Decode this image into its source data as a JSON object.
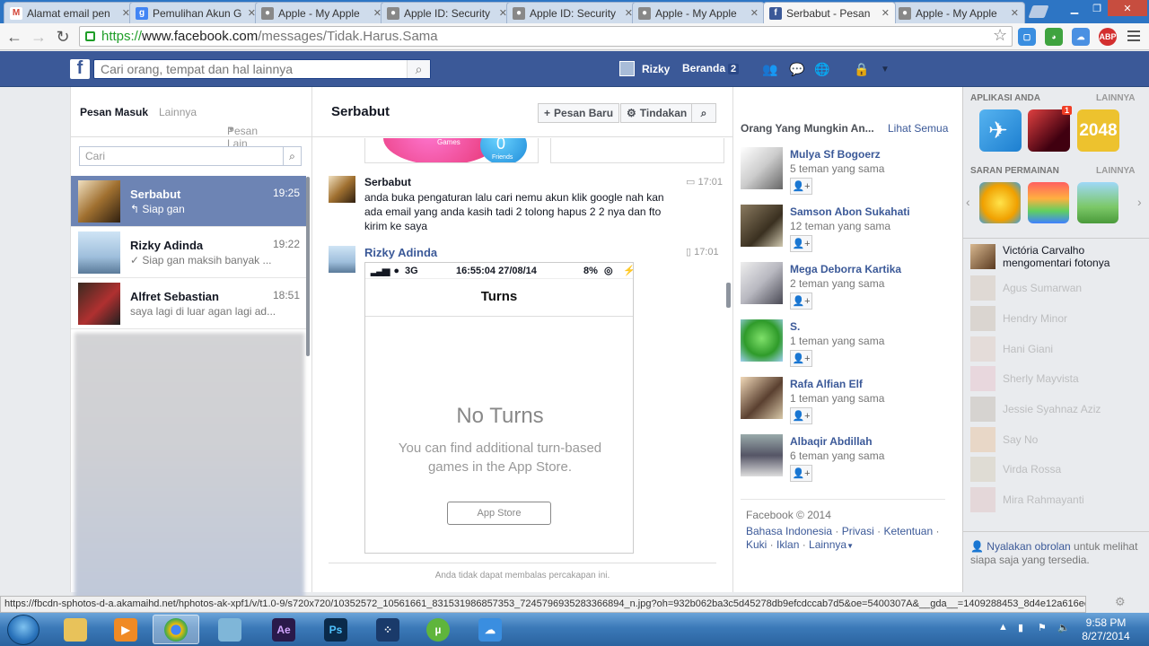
{
  "browser": {
    "tabs": [
      {
        "title": "Alamat email pen",
        "icon": "gmail-icon",
        "color": "#d44638",
        "glyph": "M"
      },
      {
        "title": "Pemulihan Akun G",
        "icon": "google-icon",
        "color": "#4285f4",
        "glyph": "g"
      },
      {
        "title": "Apple - My Apple",
        "icon": "apple-icon",
        "color": "#888888",
        "glyph": ""
      },
      {
        "title": "Apple ID: Security",
        "icon": "apple-icon",
        "color": "#888888",
        "glyph": ""
      },
      {
        "title": "Apple ID: Security",
        "icon": "apple-icon",
        "color": "#888888",
        "glyph": ""
      },
      {
        "title": "Apple - My Apple",
        "icon": "apple-icon",
        "color": "#888888",
        "glyph": ""
      },
      {
        "title": "Serbabut - Pesan",
        "icon": "facebook-icon",
        "color": "#3b5998",
        "glyph": "f",
        "active": true
      },
      {
        "title": "Apple - My Apple",
        "icon": "apple-icon",
        "color": "#888888",
        "glyph": ""
      }
    ],
    "url_scheme": "https://",
    "url_host": "www.facebook.com",
    "url_path": "/messages/Tidak.Harus.Sama"
  },
  "fb": {
    "search_placeholder": "Cari orang, tempat dan hal lainnya",
    "user_name": "Rizky",
    "home_label": "Beranda",
    "home_count": "2"
  },
  "left": {
    "tab_inbox": "Pesan Masuk",
    "tab_other": "Lainnya",
    "tab_more": "Pesan Lain",
    "search_placeholder": "Cari",
    "conversations": [
      {
        "name": "Serbabut",
        "time": "19:25",
        "snippet": "Siap gan",
        "marker": "↰"
      },
      {
        "name": "Rizky Adinda",
        "time": "19:22",
        "snippet": "Siap gan maksih banyak ...",
        "marker": "✓"
      },
      {
        "name": "Alfret Sebastian",
        "time": "18:51",
        "snippet": "saya lagi di luar agan lagi ad...",
        "marker": ""
      }
    ]
  },
  "middle": {
    "title": "Serbabut",
    "new_msg": "Pesan Baru",
    "actions": "Tindakan",
    "top_games_label": "Games",
    "top_friends_label": "Friends",
    "top_friends_count": "0",
    "messages": [
      {
        "name": "Serbabut",
        "time": "17:01",
        "text": "anda buka pengaturan lalu cari nemu akun klik google nah kan ada email yang anda kasih tadi 2 tolong hapus 2 2 nya dan fto kirim ke saya"
      },
      {
        "name": "Rizky Adinda",
        "time": "17:01"
      }
    ],
    "screenshot": {
      "carrier": "3G",
      "datetime": "16:55:04 27/08/14",
      "battery": "8%",
      "header": "Turns",
      "no_turns": "No Turns",
      "subtitle": "You can find additional turn-based games in the App Store.",
      "button": "App Store"
    },
    "no_reply": "Anda tidak dapat membalas percakapan ini."
  },
  "pymk": {
    "heading": "Orang Yang Mungkin An...",
    "see_all": "Lihat Semua",
    "people": [
      {
        "name": "Mulya Sf Bogoerz",
        "mutual": "5 teman yang sama"
      },
      {
        "name": "Samson Abon Sukahati",
        "mutual": "12 teman yang sama"
      },
      {
        "name": "Mega Deborra Kartika",
        "mutual": "2 teman yang sama"
      },
      {
        "name": "S.",
        "mutual": "1 teman yang sama"
      },
      {
        "name": "Rafa Alfian Elf",
        "mutual": "1 teman yang sama"
      },
      {
        "name": "Albaqir Abdillah",
        "mutual": "6 teman yang sama"
      }
    ],
    "footer_copy": "Facebook © 2014",
    "footer_links": [
      "Bahasa Indonesia",
      "Privasi",
      "Ketentuan",
      "Kuki",
      "Iklan",
      "Lainnya"
    ]
  },
  "chat": {
    "apps_heading": "APLIKASI ANDA",
    "apps_more": "LAINNYA",
    "app_badge": "1",
    "app_2048": "2048",
    "games_heading": "SARAN PERMAINAN",
    "games_more": "LAINNYA",
    "top_friend_name": "Victória Carvalho",
    "top_friend_action": "mengomentari fotonya",
    "friends": [
      "Agus Sumarwan",
      "Hendry Minor",
      "Hani Giani",
      "Sherly Mayvista",
      "Jessie Syahnaz Aziz",
      "Say No",
      "Virda Rossa",
      "Mira Rahmayanti"
    ],
    "chat_off_link": "Nyalakan obrolan",
    "chat_off_text": "untuk melihat siapa saja yang tersedia."
  },
  "status_url": "https://fbcdn-sphotos-d-a.akamaihd.net/hphotos-ak-xpf1/v/t1.0-9/s720x720/10352572_10561661_831531986857353_7245796935283366894_n.jpg?oh=932b062ba3c5d45278db9efcdccab7d5&oe=5400307A&__gda__=1409288453_8d4e12a616ee3ed8bfa6f3c426d29afd",
  "taskbar": {
    "time": "9:58 PM",
    "date": "8/27/2014"
  },
  "colors": {
    "fb_blue": "#3b5998",
    "selected_conv": "#6d84b4"
  }
}
